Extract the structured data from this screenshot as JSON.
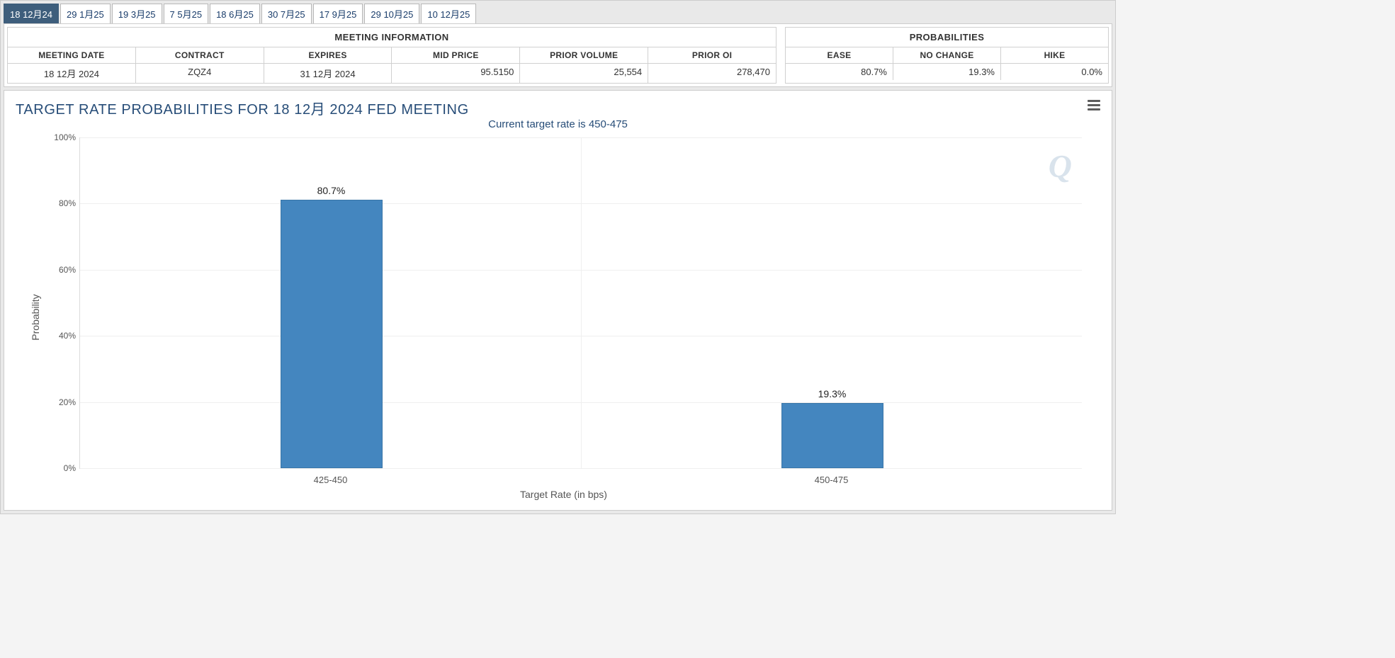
{
  "tabs": [
    {
      "label": "18 12月24",
      "active": true
    },
    {
      "label": "29 1月25",
      "active": false
    },
    {
      "label": "19 3月25",
      "active": false
    },
    {
      "label": "7 5月25",
      "active": false
    },
    {
      "label": "18 6月25",
      "active": false
    },
    {
      "label": "30 7月25",
      "active": false
    },
    {
      "label": "17 9月25",
      "active": false
    },
    {
      "label": "29 10月25",
      "active": false
    },
    {
      "label": "10 12月25",
      "active": false
    }
  ],
  "meeting_info": {
    "title": "MEETING INFORMATION",
    "columns": {
      "meeting_date": "MEETING DATE",
      "contract": "CONTRACT",
      "expires": "EXPIRES",
      "mid_price": "MID PRICE",
      "prior_volume": "PRIOR VOLUME",
      "prior_oi": "PRIOR OI"
    },
    "row": {
      "meeting_date": "18 12月 2024",
      "contract": "ZQZ4",
      "expires": "31 12月 2024",
      "mid_price": "95.5150",
      "prior_volume": "25,554",
      "prior_oi": "278,470"
    }
  },
  "probabilities": {
    "title": "PROBABILITIES",
    "columns": {
      "ease": "EASE",
      "no_change": "NO CHANGE",
      "hike": "HIKE"
    },
    "row": {
      "ease": "80.7%",
      "no_change": "19.3%",
      "hike": "0.0%"
    }
  },
  "chart_title": "TARGET RATE PROBABILITIES FOR 18 12月 2024 FED MEETING",
  "chart_subtitle": "Current target rate is 450-475",
  "watermark": "Q",
  "chart_data": {
    "type": "bar",
    "title": "TARGET RATE PROBABILITIES FOR 18 12月 2024 FED MEETING",
    "subtitle": "Current target rate is 450-475",
    "xlabel": "Target Rate (in bps)",
    "ylabel": "Probability",
    "ylim": [
      0,
      100
    ],
    "yticks": [
      0,
      20,
      40,
      60,
      80,
      100
    ],
    "ytick_format": "{v}%",
    "categories": [
      "425-450",
      "450-475"
    ],
    "values": [
      80.7,
      19.3
    ],
    "value_labels": [
      "80.7%",
      "19.3%"
    ],
    "bar_color": "#4486bf"
  }
}
